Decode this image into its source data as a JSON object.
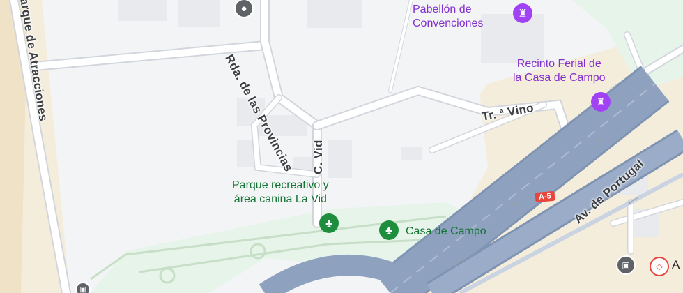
{
  "map": {
    "streets": {
      "rda_provincias": "Rda. de las Provincias",
      "parque_atracciones": "arque de Atracciones",
      "c_vid": "C. Vid",
      "tr_vino": "Tr. ª Vino",
      "av_portugal": "Av. de Portugal",
      "a5_shield": "A-5"
    },
    "pois": {
      "pabellon": "Pabellón de\nConvenciones",
      "recinto": "Recinto Ferial de\nla Casa de Campo",
      "parque_recreativo": "Parque recreativo y\nárea canina La Vid",
      "casa_de_campo": "Casa de Campo",
      "edge_label": "A"
    },
    "icons": {
      "pabellon_icon": "castle-icon",
      "recinto_icon": "castle-icon",
      "parque_icon": "tree-icon",
      "casa_icon": "tree-icon",
      "place_pin": "place-pin-icon",
      "bus_icon": "bus-icon",
      "metro_icon": "metro-icon"
    },
    "colors": {
      "background": "#f3f4f6",
      "park": "#e6f4ea",
      "sand": "#f5eddc",
      "highway": "#8ea2c0",
      "street": "#ffffff",
      "purple_poi": "#8430ce",
      "green_poi": "#137333"
    }
  }
}
